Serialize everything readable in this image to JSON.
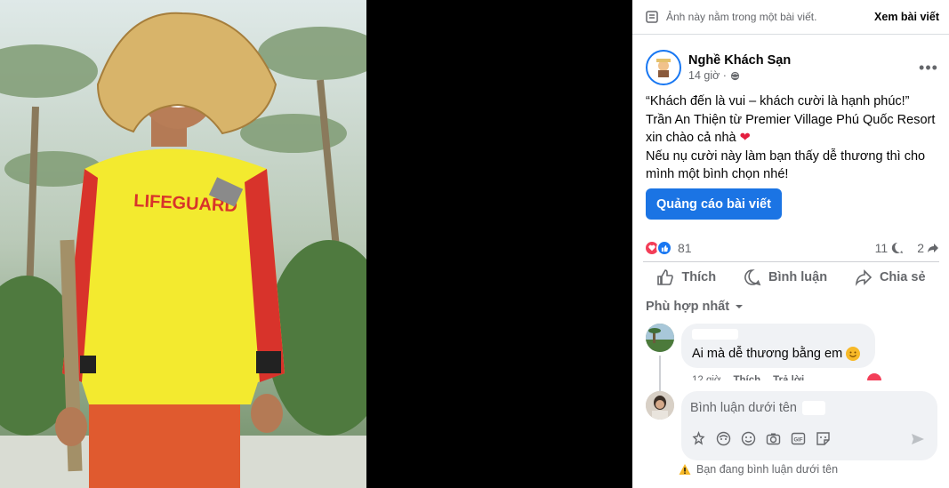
{
  "notice": {
    "text": "Ảnh này nằm trong một bài viết.",
    "view_post": "Xem bài viết"
  },
  "post": {
    "author": "Nghề Khách Sạn",
    "time": "14 giờ",
    "caption_lines": [
      "“Khách đến là vui – khách cười là hạnh phúc!”",
      "Trần An Thiện từ Premier Village Phú Quốc Resort",
      "xin chào cả nhà",
      "Nếu nụ cười này làm bạn thấy dễ thương thì cho",
      "mình một bình chọn nhé!"
    ],
    "boost_label": "Quảng cáo bài viết"
  },
  "photo": {
    "shirt_text": "LIFEGUARD"
  },
  "stats": {
    "reactions": "81",
    "comments": "11",
    "shares": "2"
  },
  "actions": {
    "like": "Thích",
    "comment": "Bình luận",
    "share": "Chia sẻ"
  },
  "sort_label": "Phù hợp nhất",
  "comment": {
    "text": "Ai mà dễ thương bằng em",
    "time": "12 giờ",
    "like": "Thích",
    "reply": "Trả lời"
  },
  "composer": {
    "placeholder": "Bình luận dưới tên",
    "warning": "Bạn đang bình luận dưới tên"
  },
  "colors": {
    "brand": "#1b74e4",
    "love": "#f33e58",
    "shirt": "#f3ea2f"
  },
  "icons": [
    "doc-icon",
    "globe-icon",
    "more-icon",
    "like-icon",
    "comment-icon",
    "share-icon",
    "chevron-down-icon",
    "sticker-icon",
    "emoji-icon",
    "camera-icon",
    "gif-icon",
    "send-icon",
    "warning-icon"
  ]
}
